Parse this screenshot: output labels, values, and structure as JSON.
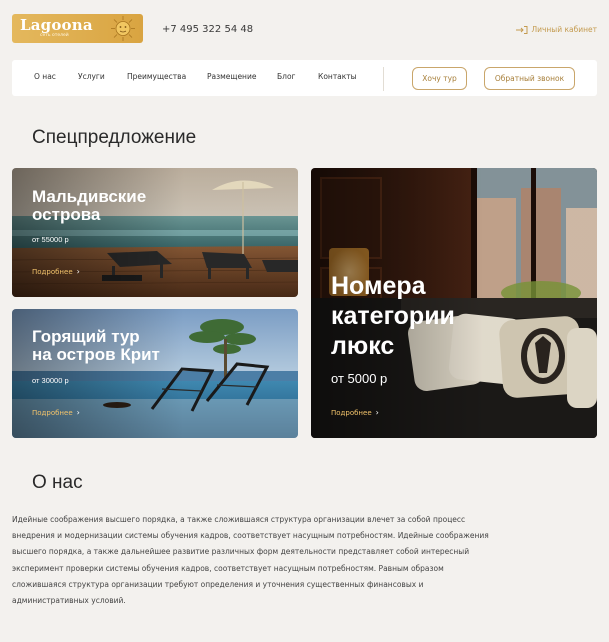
{
  "header": {
    "logo_title": "Lagoona",
    "logo_sub": "сеть отелей",
    "phone": "+7 495 322 54 48",
    "cabinet": "Личный кабинет"
  },
  "nav": {
    "items": [
      "О нас",
      "Услуги",
      "Преимущества",
      "Размещение",
      "Блог",
      "Контакты"
    ],
    "btn_tour": "Хочу тур",
    "btn_call": "Обратный звонок"
  },
  "special": {
    "heading": "Спецпредложение",
    "cards": [
      {
        "title_line1": "Мальдивские",
        "title_line2": "острова",
        "price": "от 55000 р",
        "more": "Подробнее"
      },
      {
        "title_line1": "Горящий тур",
        "title_line2": "на остров Крит",
        "price": "от 30000 р",
        "more": "Подробнее"
      },
      {
        "title_line1": "Номера",
        "title_line2": "категории",
        "title_line3": "люкс",
        "price": "от 5000 р",
        "more": "Подробнее"
      }
    ]
  },
  "about": {
    "heading": "О нас",
    "text": "Идейные соображения высшего порядка, а также сложившаяся структура организации влечет за собой процесс внедрения и модернизации системы обучения кадров, соответствует насущным потребностям. Идейные соображения высшего порядка, а также дальнейшее развитие различных форм деятельности представляет собой интересный эксперимент проверки системы обучения кадров, соответствует насущным потребностям. Равным образом сложившаяся структура организации требуют определения и уточнения существенных финансовых и административных условий."
  },
  "colors": {
    "accent": "#c49b4f",
    "logo": "#d9a441",
    "link": "#f2c36b"
  },
  "icons": {
    "cabinet": "login-icon",
    "logo": "sun-icon",
    "more": "chevron-right-icon"
  }
}
